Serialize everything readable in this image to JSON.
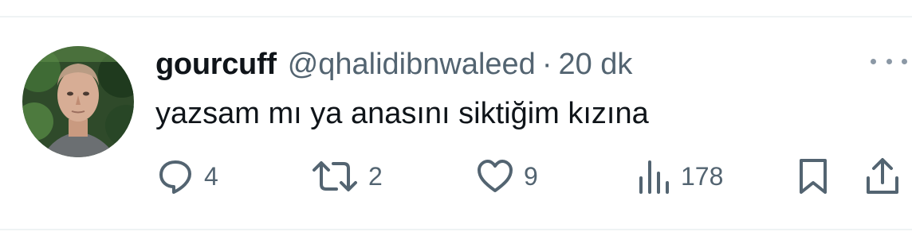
{
  "tweet": {
    "display_name": "gourcuff",
    "handle": "@qhalidibnwaleed",
    "separator": "·",
    "time": "20 dk",
    "text": "yazsam mı ya anasını siktiğim kızına"
  },
  "actions": {
    "replies": "4",
    "retweets": "2",
    "likes": "9",
    "views": "178"
  },
  "icons": {
    "reply": "reply-icon",
    "retweet": "retweet-icon",
    "like": "heart-icon",
    "views": "views-icon",
    "bookmark": "bookmark-icon",
    "share": "share-icon",
    "more": "more-icon"
  },
  "colors": {
    "text_primary": "#0f1419",
    "text_secondary": "#536471",
    "divider": "#eff3f4"
  }
}
